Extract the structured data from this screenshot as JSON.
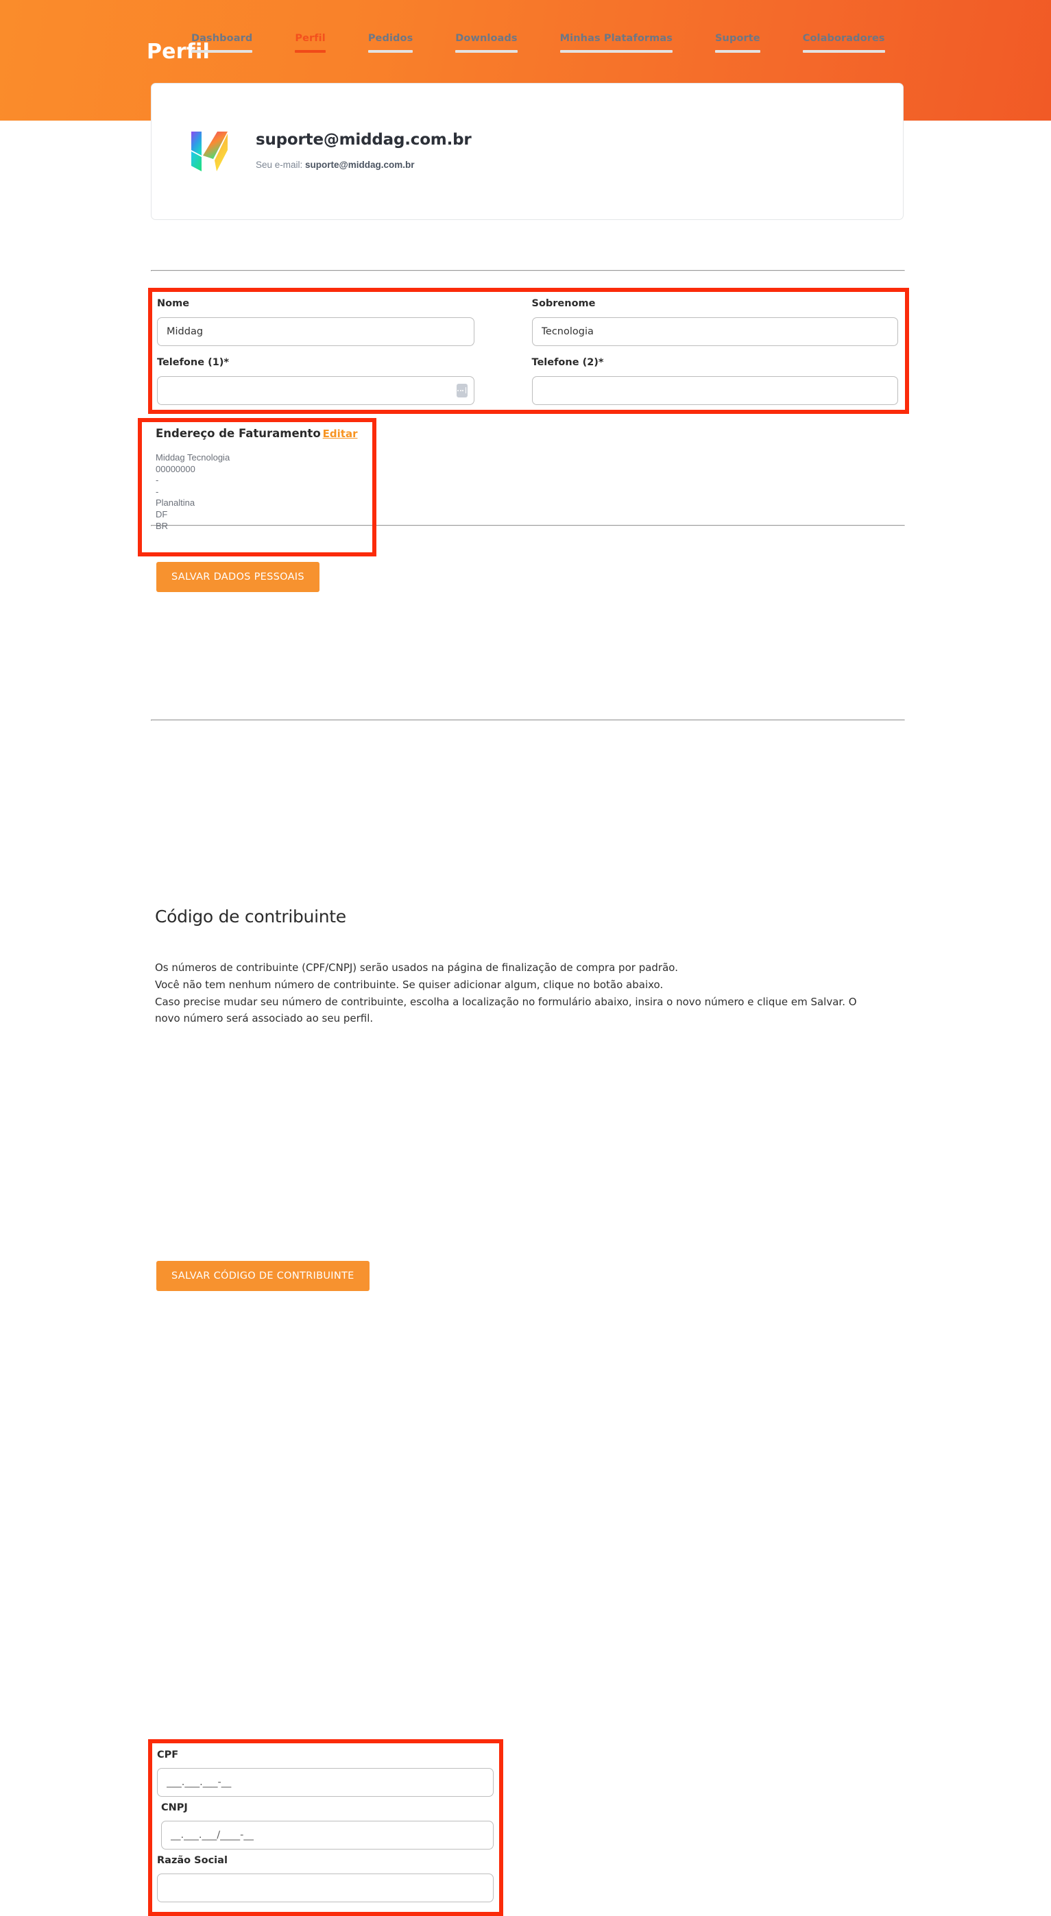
{
  "header": {
    "title": "Perfil",
    "gradient_from": "#FA8C2B",
    "gradient_to": "#F15A26"
  },
  "tabs": [
    {
      "label": "Dashboard",
      "active": false
    },
    {
      "label": "Perfil",
      "active": true
    },
    {
      "label": "Pedidos",
      "active": false
    },
    {
      "label": "Downloads",
      "active": false
    },
    {
      "label": "Minhas Plataformas",
      "active": false
    },
    {
      "label": "Suporte",
      "active": false
    },
    {
      "label": "Colaboradores",
      "active": false
    }
  ],
  "profile": {
    "logo_icon": "middag-m-logo-icon",
    "email_heading": "suporte@middag.com.br",
    "email_label": "Seu e-mail:",
    "email_value": "suporte@middag.com.br"
  },
  "personal_form": {
    "nome": {
      "label": "Nome",
      "value": "Middag"
    },
    "sobrenome": {
      "label": "Sobrenome",
      "value": "Tecnologia"
    },
    "telefone1": {
      "label": "Telefone (1)*",
      "value": "",
      "placeholder": ""
    },
    "telefone2": {
      "label": "Telefone (2)*",
      "value": "",
      "placeholder": ""
    },
    "save_label": "SALVAR DADOS PESSOAIS"
  },
  "billing_address": {
    "title": "Endereço de Faturamento",
    "edit_label": "Editar",
    "lines": [
      "Middag Tecnologia",
      "00000000",
      "-",
      "-",
      "Planaltina",
      "DF",
      "BR"
    ]
  },
  "tax_section": {
    "title": "Código de contribuinte",
    "paragraph_lines": [
      "Os números de contribuinte (CPF/CNPJ) serão usados na página de finalização de compra por padrão.",
      "Você não tem nenhum número de contribuinte. Se quiser adicionar algum, clique no botão abaixo.",
      "Caso precise mudar seu número de contribuinte, escolha a localização no formulário abaixo, insira o novo número e clique em Salvar. O novo número será associado ao seu perfil."
    ],
    "cpf": {
      "label": "CPF",
      "value": "",
      "placeholder": "___.___.___-__"
    },
    "cnpj": {
      "label": "CNPJ",
      "value": "",
      "placeholder": "__.___.___/____-__"
    },
    "razao_social": {
      "label": "Razão Social",
      "value": "",
      "placeholder": ""
    },
    "save_label": "SALVAR CÓDIGO DE CONTRIBUINTE"
  },
  "highlights": {
    "color": "#FB2B0A",
    "regions": [
      "personal-data-form",
      "billing-address-block",
      "tax-code-form"
    ]
  },
  "theme": {
    "accent_orange": "#F7922F",
    "active_tab": "#F3501D",
    "link_orange": "#F79422",
    "divider": "#E6E6E6"
  }
}
